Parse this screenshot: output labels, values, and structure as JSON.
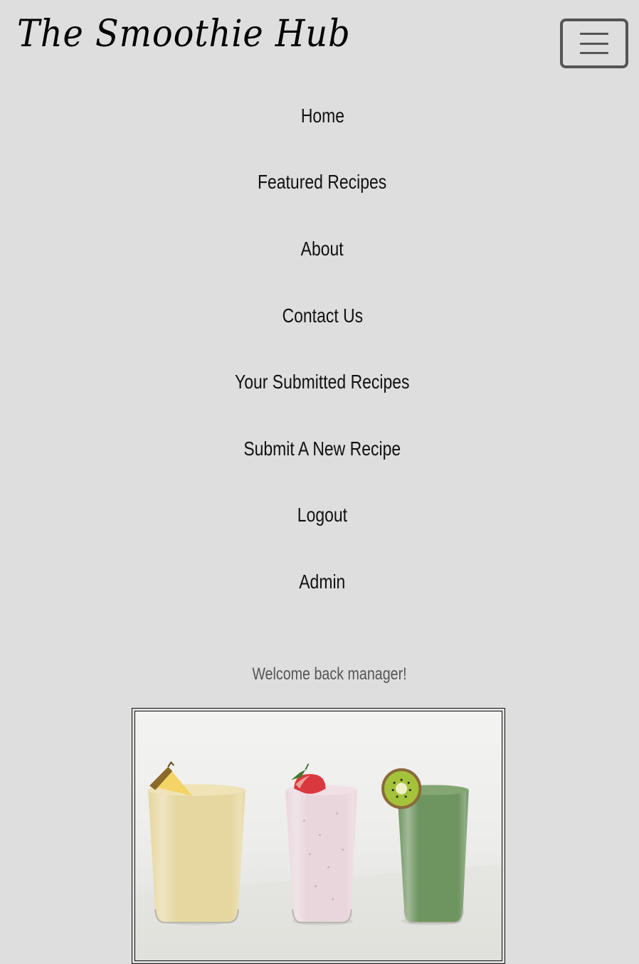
{
  "brand": {
    "name": "The Smoothie Hub"
  },
  "nav": {
    "toggle_icon": "hamburger-icon",
    "items": [
      {
        "label": "Home"
      },
      {
        "label": "Featured Recipes"
      },
      {
        "label": "About"
      },
      {
        "label": "Contact Us"
      },
      {
        "label": "Your Submitted Recipes"
      },
      {
        "label": "Submit A New Recipe"
      },
      {
        "label": "Logout"
      },
      {
        "label": "Admin"
      }
    ]
  },
  "welcome": {
    "message": "Welcome back manager!"
  },
  "hero": {
    "image_subject": "three-smoothie-glasses",
    "glasses": [
      {
        "flavor": "pineapple",
        "color": "#e6d7a0"
      },
      {
        "flavor": "strawberry",
        "color": "#e9d6dc"
      },
      {
        "flavor": "kiwi",
        "color": "#6e9460"
      }
    ]
  },
  "colors": {
    "background": "#dedede",
    "text": "#111111",
    "muted_text": "#555555",
    "toggler_border": "#555555"
  }
}
